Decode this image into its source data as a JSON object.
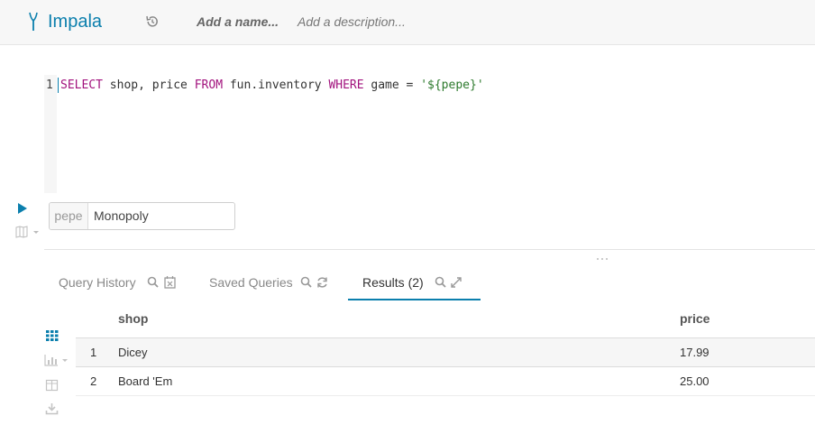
{
  "header": {
    "app_title": "Impala",
    "name_placeholder": "Add a name...",
    "description_placeholder": "Add a description..."
  },
  "editor": {
    "line_number": "1",
    "query": {
      "kw_select": "SELECT",
      "t1": " shop, price ",
      "kw_from": "FROM",
      "t2": " fun.inventory ",
      "kw_where": "WHERE",
      "t3": " game = ",
      "str_value": "'${pepe}'"
    }
  },
  "variable": {
    "name": "pepe",
    "value": "Monopoly"
  },
  "tabs": [
    {
      "label": "Query History"
    },
    {
      "label": "Saved Queries"
    },
    {
      "label": "Results (2)"
    }
  ],
  "results": {
    "columns": [
      "shop",
      "price"
    ],
    "rows": [
      {
        "num": "1",
        "shop": "Dicey",
        "price": "17.99"
      },
      {
        "num": "2",
        "shop": "Board 'Em",
        "price": "25.00"
      }
    ]
  },
  "colors": {
    "accent": "#0b7fad",
    "keyword": "#a2127d",
    "string": "#2d7a2d"
  }
}
